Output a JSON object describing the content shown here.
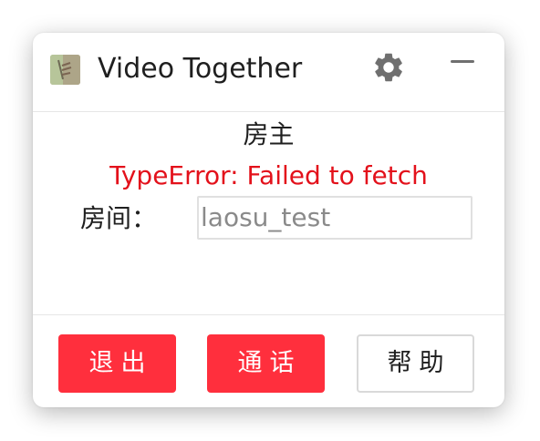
{
  "header": {
    "title": "Video Together",
    "logo_icon": "app-logo-icon",
    "settings_icon": "gear-icon",
    "minimize_icon": "minimize-icon"
  },
  "main": {
    "role": "房主",
    "error_text": "TypeError: Failed to fetch",
    "room_label": "房间：",
    "room_value": "laosu_test"
  },
  "footer": {
    "exit_label": "退出",
    "call_label": "通话",
    "help_label": "帮助"
  },
  "colors": {
    "accent_red": "#ff2f3d",
    "error_red": "#e3111b",
    "text": "#1f1f1f",
    "input_text": "#8a8a8a"
  }
}
